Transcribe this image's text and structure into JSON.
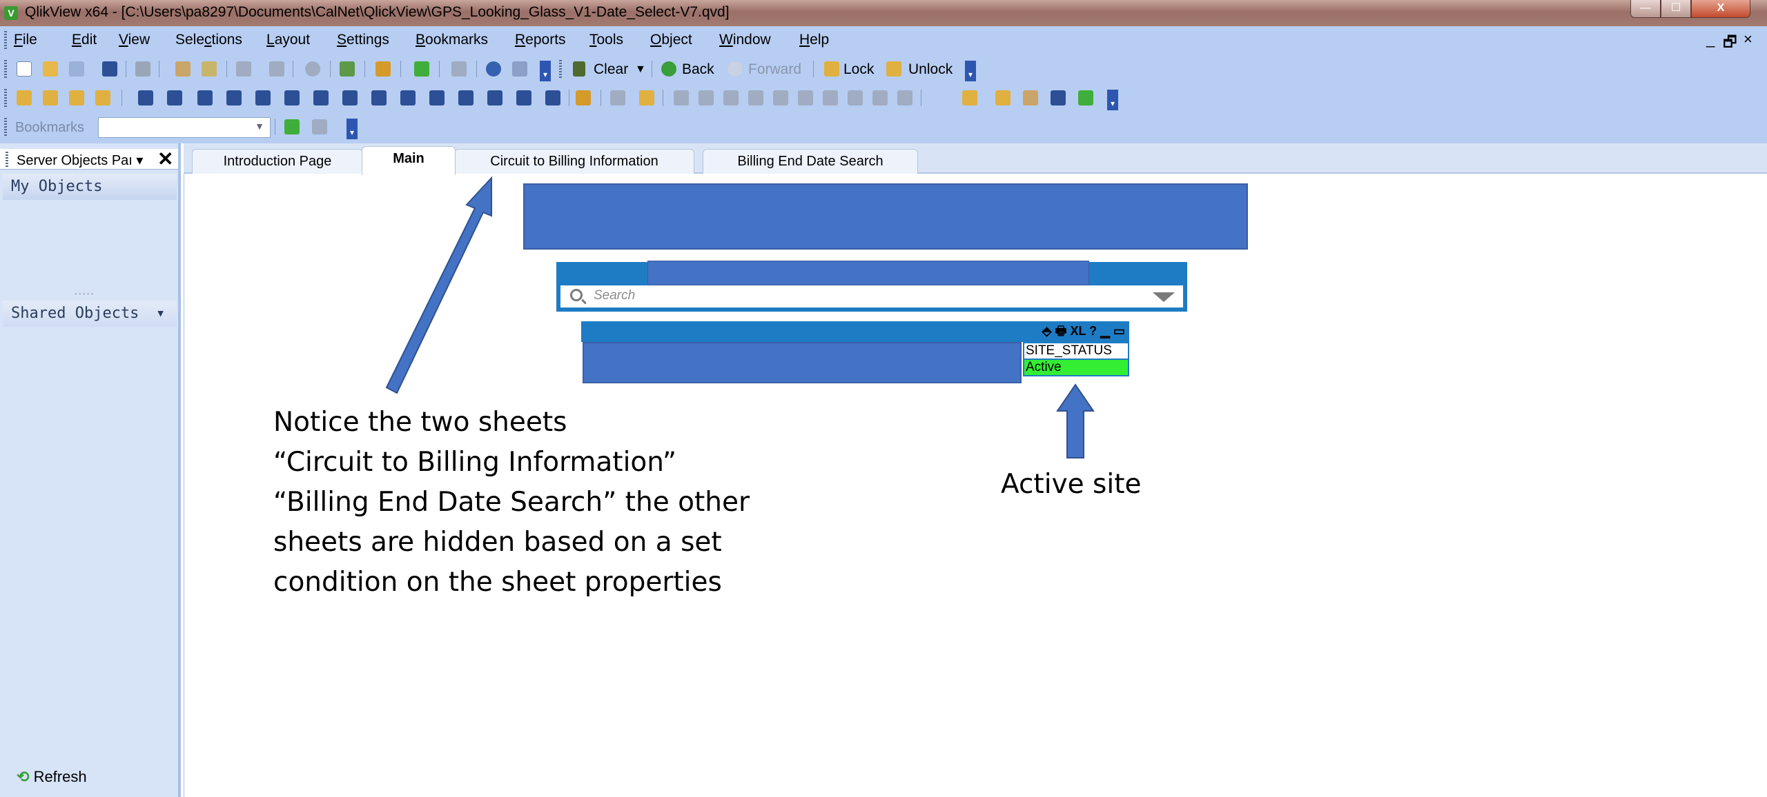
{
  "window": {
    "app_icon": "V",
    "title": "QlikView x64 - [C:\\Users\\pa8297\\Documents\\CalNet\\QlickView\\GPS_Looking_Glass_V1-Date_Select-V7.qvd]",
    "min_glyph": "—",
    "max_glyph": "☐",
    "close_glyph": "X"
  },
  "menu": {
    "items": [
      {
        "label": "File",
        "key": "F",
        "rest": "ile"
      },
      {
        "label": "Edit",
        "key": "E",
        "rest": "dit"
      },
      {
        "label": "View",
        "key": "V",
        "rest": "iew"
      },
      {
        "label": "Selections",
        "pre": "Sele",
        "key": "c",
        "rest": "tions"
      },
      {
        "label": "Layout",
        "key": "L",
        "rest": "ayout"
      },
      {
        "label": "Settings",
        "key": "S",
        "rest": "ettings"
      },
      {
        "label": "Bookmarks",
        "key": "B",
        "rest": "ookmarks"
      },
      {
        "label": "Reports",
        "key": "R",
        "rest": "eports"
      },
      {
        "label": "Tools",
        "key": "T",
        "rest": "ools"
      },
      {
        "label": "Object",
        "key": "O",
        "rest": "bject"
      },
      {
        "label": "Window",
        "key": "W",
        "rest": "indow"
      },
      {
        "label": "Help",
        "key": "H",
        "rest": "elp"
      }
    ],
    "mdi_min": "_",
    "mdi_restore": "🗗",
    "mdi_close": "×"
  },
  "toolbar": {
    "clear_label": "Clear",
    "back_label": "Back",
    "forward_label": "Forward",
    "lock_label": "Lock",
    "unlock_label": "Unlock",
    "bookmarks_label": "Bookmarks",
    "overflow_glyph": "▾"
  },
  "left_panel": {
    "title": "Server Objects Paı",
    "dropdown_glyph": "▾",
    "close_glyph": "✕",
    "my_objects": "My Objects",
    "shared_objects": "Shared Objects",
    "shared_dropdown": "▾",
    "splitter_dots": ".....",
    "refresh_label": "Refresh"
  },
  "tabs": [
    {
      "label": "Introduction Page",
      "active": false
    },
    {
      "label": "Main",
      "active": true
    },
    {
      "label": "Circuit to Billing Information",
      "active": false
    },
    {
      "label": "Billing End Date Search",
      "active": false
    }
  ],
  "sheet": {
    "search_placeholder": "Search",
    "table_caption_icons": "⬘ 🖶 XL ? ▁ ▭",
    "site_status_header": "SITE_STATUS",
    "site_status_value": "Active",
    "status_color": "#33ee33",
    "accent_color": "#4472c4"
  },
  "annotations": {
    "notice_lines": [
      "Notice the two sheets",
      "“Circuit to Billing Information”",
      "“Billing End Date Search” the other",
      "sheets are hidden based on a set",
      "condition on the sheet properties"
    ],
    "active_site": "Active site"
  }
}
